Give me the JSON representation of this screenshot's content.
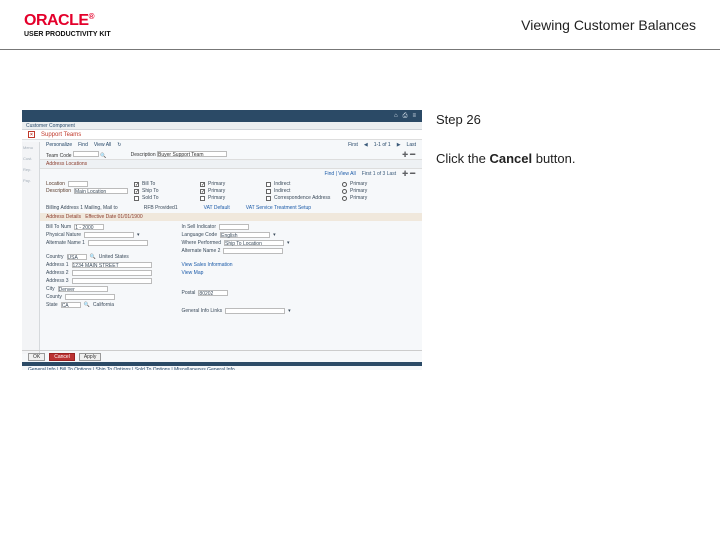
{
  "header": {
    "logo_brand": "ORACLE",
    "logo_tm": "®",
    "logo_sub": "USER PRODUCTIVITY KIT",
    "title": "Viewing Customer Balances"
  },
  "step": {
    "label": "Step 26",
    "text_before": "Click the ",
    "bold": "Cancel",
    "text_after": " button."
  },
  "shot": {
    "window_title": "Customer Component",
    "redline": "Support Teams",
    "tb_left": [
      "Personalize",
      "Find",
      "View All"
    ],
    "tb_right": [
      "First",
      "1-1 of 1",
      "Last"
    ],
    "effdate_lbl": "Team Code",
    "desc_lbl": "Description",
    "desc_val": "Buyer Support Team",
    "address_loc": "Address Locations",
    "loc_lbl": "Location",
    "loc_val": "1",
    "desc2_lbl": "Description",
    "desc2_val": "Main Location",
    "billto": "Bill To",
    "shipto": "Ship To",
    "soldto": "Sold To",
    "primary": "Primary",
    "indlabel": "Indirect",
    "corr": "Correspondence Address",
    "findview": "Find | View All",
    "pager": "First  1 of 3  Last",
    "bill_addr_lbl": "Billing Address",
    "bill_addr_val": "1 Mailing, Mail to",
    "rfb": "RFB Provided",
    "rfb_val": "1",
    "vat": "VAT Default",
    "vat2": "VAT Service Treatment Setup",
    "underline": "Address Details",
    "underline_val": "Effective Date 01/01/1900",
    "bto_num": "Bill To Num",
    "bto_val": "1 - 2000",
    "alt1": "Alternate Name 1",
    "alt2": "Alternate Name 2",
    "ins": "In Sell Indicator",
    "lang": "Language Code",
    "lang_val": "English",
    "where": "Where Performed",
    "where_val": "Ship To Location",
    "phys": "Physical Nature",
    "country_lbl": "Country",
    "country_val": "USA",
    "country_name": "United States",
    "a1": "Address 1",
    "a1_val": "1234 MAIN STREET",
    "a2": "Address 2",
    "a3": "Address 3",
    "city_lbl": "City",
    "city_val": "Denver",
    "postal_lbl": "Postal",
    "postal_val": "80202",
    "county_lbl": "County",
    "state_lbl": "State",
    "state_val": "CA",
    "state_name": "California",
    "viewsales": "View Sales Information",
    "viewmap": "View Map",
    "genlinks": "General Info Links",
    "btn_ok": "OK",
    "btn_cancel": "Cancel",
    "btn_apply": "Apply",
    "bottomlinks": "General Info | Bill To Options | Ship To Options | Sold To Options | Miscellaneous General Info"
  }
}
